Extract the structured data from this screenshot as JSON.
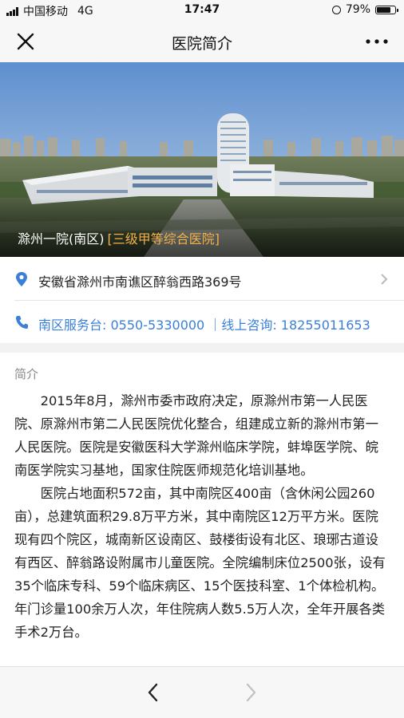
{
  "status_bar": {
    "carrier": "中国移动",
    "network": "4G",
    "time": "17:47",
    "battery": "79%",
    "battery_level": 0.79,
    "icons": [
      "signal-icon",
      "orientation-lock-icon",
      "battery-icon"
    ]
  },
  "nav": {
    "title": "医院简介",
    "icons": [
      "close-icon",
      "more-icon"
    ]
  },
  "hero": {
    "name": "滁州一院(南区)",
    "level": "[三级甲等综合医院]"
  },
  "address": {
    "text": "安徽省滁州市南谯区醉翁西路369号",
    "icons": [
      "location-pin-icon",
      "chevron-right-icon"
    ]
  },
  "contact": {
    "text": "南区服务台: 0550-5330000 ｜线上咨询: 18255011653",
    "icon": "phone-icon"
  },
  "intro": {
    "heading": "简介",
    "paragraphs": [
      "2015年8月，滁州市委市政府决定，原滁州市第一人民医院、原滁州市第二人民医院优化整合，组建成立新的滁州市第一人民医院。医院是安徽医科大学滁州临床学院，蚌埠医学院、皖南医学院实习基地，国家住院医师规范化培训基地。",
      "医院占地面积572亩，其中南院区400亩（含休闲公园260亩），总建筑面积29.8万平方米，其中南院区12万平方米。医院现有四个院区，城南新区设南区、鼓楼街设有北区、琅琊古道设有西区、醉翁路设附属市儿童医院。全院编制床位2500张，设有35个临床专科、59个临床病区、15个医技科室、1个体检机构。年门诊量100余万人次，年住院病人数5.5万人次，全年开展各类手术2万台。"
    ]
  },
  "bottom_bar": {
    "icons": [
      "back-arrow-icon",
      "forward-arrow-icon"
    ]
  },
  "colors": {
    "accent_blue": "#3b7fd9",
    "level_orange": "#f2b14a",
    "bar_background": "#f7f7f7"
  }
}
